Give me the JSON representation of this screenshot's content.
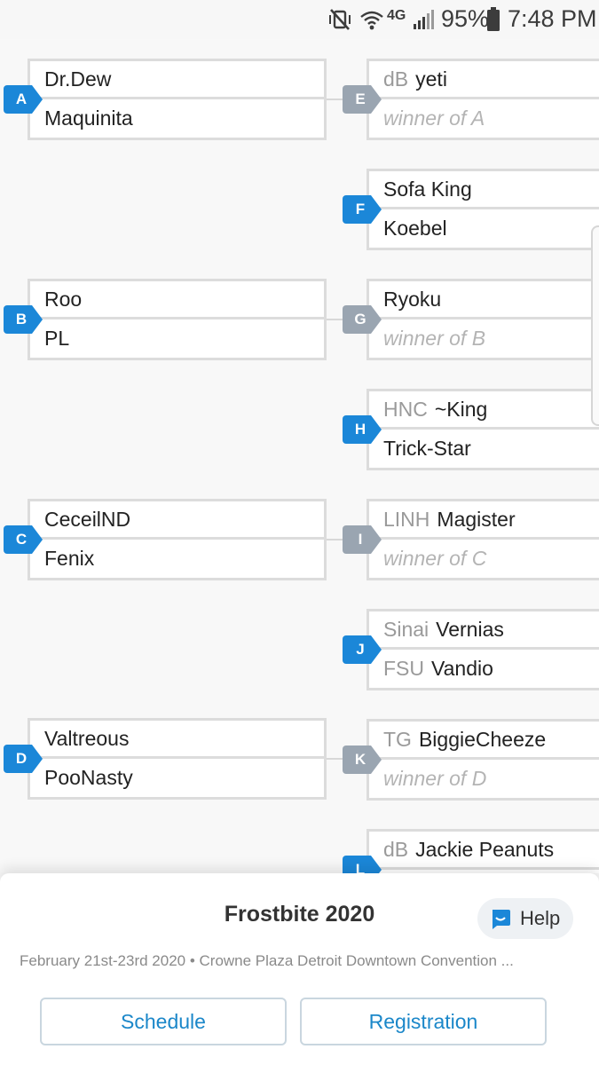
{
  "status_bar": {
    "network": "4G",
    "battery": "95%",
    "time": "7:48 PM",
    "icons": [
      "mute-vibrate-icon",
      "wifi-icon",
      "lte-icon",
      "signal-icon",
      "battery-icon"
    ]
  },
  "colors": {
    "active_label": "#1b87d8",
    "inactive_label": "#9aa5b1",
    "accent_text": "#1b87c9"
  },
  "bracket": {
    "round1": [
      {
        "label": "A",
        "top": {
          "name": "Dr.Dew"
        },
        "bottom": {
          "name": "Maquinita"
        }
      },
      {
        "label": "B",
        "top": {
          "name": "Roo"
        },
        "bottom": {
          "name": "PL"
        }
      },
      {
        "label": "C",
        "top": {
          "name": "CeceilND"
        },
        "bottom": {
          "name": "Fenix"
        }
      },
      {
        "label": "D",
        "top": {
          "name": "Valtreous"
        },
        "bottom": {
          "name": "PooNasty"
        }
      }
    ],
    "round2": [
      {
        "label": "E",
        "top": {
          "prefix": "dB",
          "name": "yeti"
        },
        "bottom": {
          "placeholder": "winner of A"
        }
      },
      {
        "label": "F",
        "top": {
          "name": "Sofa King"
        },
        "bottom": {
          "name": "Koebel"
        }
      },
      {
        "label": "G",
        "top": {
          "name": "Ryoku"
        },
        "bottom": {
          "placeholder": "winner of B"
        }
      },
      {
        "label": "H",
        "top": {
          "prefix": "HNC",
          "name": "~King"
        },
        "bottom": {
          "name": "Trick-Star"
        }
      },
      {
        "label": "I",
        "top": {
          "prefix": "LINH",
          "name": "Magister"
        },
        "bottom": {
          "placeholder": "winner of C"
        }
      },
      {
        "label": "J",
        "top": {
          "prefix": "Sinai",
          "name": "Vernias"
        },
        "bottom": {
          "prefix": "FSU",
          "name": "Vandio"
        }
      },
      {
        "label": "K",
        "top": {
          "prefix": "TG",
          "name": "BiggieCheeze"
        },
        "bottom": {
          "placeholder": "winner of D"
        }
      },
      {
        "label": "L",
        "top": {
          "prefix": "dB",
          "name": "Jackie Peanuts"
        },
        "bottom": {
          "name": ""
        }
      }
    ]
  },
  "event": {
    "title": "Frostbite 2020",
    "subtitle": "February 21st-23rd 2020 • Crowne Plaza Detroit Downtown Convention ...",
    "help_label": "Help",
    "schedule_label": "Schedule",
    "registration_label": "Registration"
  }
}
